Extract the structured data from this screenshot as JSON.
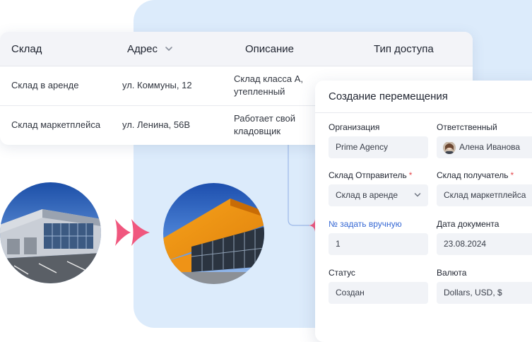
{
  "table": {
    "headers": {
      "warehouse": "Склад",
      "address": "Адрес",
      "description": "Описание",
      "access": "Тип доступа"
    },
    "rows": [
      {
        "warehouse": "Склад в аренде",
        "address": "ул. Коммуны, 12",
        "desc_line1": "Склад класса А,",
        "desc_line2": "утепленный"
      },
      {
        "warehouse": "Склад маркетплейса",
        "address": "ул. Ленина, 56В",
        "desc_line1": "Работает свой",
        "desc_line2": "кладовщик"
      }
    ]
  },
  "form": {
    "title": "Создание перемещения",
    "organization": {
      "label": "Организация",
      "value": "Prime Agency"
    },
    "responsible": {
      "label": "Ответственный",
      "value": "Алена Иванова"
    },
    "sender": {
      "label": "Склад Отправитель",
      "required": "*",
      "value": "Склад в аренде"
    },
    "receiver": {
      "label": "Склад получатель",
      "required": "*",
      "value": "Склад маркетплейса"
    },
    "number": {
      "label": "№ задать вручную",
      "value": "1"
    },
    "date": {
      "label": "Дата документа",
      "value": "23.08.2024"
    },
    "status": {
      "label": "Статус",
      "value": "Создан"
    },
    "currency": {
      "label": "Валюта",
      "value": "Dollars, USD, $"
    }
  },
  "colors": {
    "accent_link": "#3668d4",
    "required": "#e5484d",
    "arrow": "#f0577e",
    "panel": "#dcebfb"
  },
  "icons": [
    "chevron-down-icon",
    "double-arrow-icon",
    "sparkle-icon"
  ]
}
